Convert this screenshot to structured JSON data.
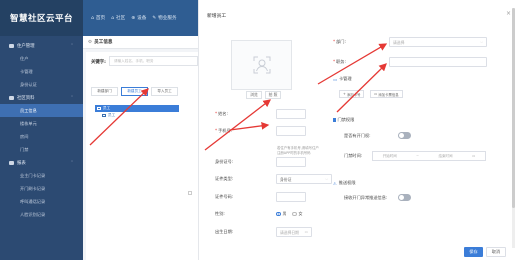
{
  "sidebar": {
    "brand": "智慧社区云平台",
    "groups": [
      {
        "label": "住户管理",
        "items": [
          "住户",
          "卡管理",
          "身份认证"
        ]
      },
      {
        "label": "社区资料",
        "items": [
          "员工信息",
          "楼栋单元",
          "房间",
          "门禁"
        ]
      },
      {
        "label": "报表",
        "items": [
          "业主门卡记录",
          "开门刷卡记录",
          "呼叫通话记录",
          "人脸识别记录"
        ]
      }
    ],
    "active_item": "员工信息"
  },
  "topbar": {
    "items": [
      {
        "icon": "⌂",
        "label": "首页"
      },
      {
        "icon": "⌂",
        "label": "社区"
      },
      {
        "icon": "⊕",
        "label": "设备"
      },
      {
        "icon": "✎",
        "label": "物业服务"
      }
    ]
  },
  "content": {
    "breadcrumb": "员工信息",
    "keyword_label": "关键字:",
    "keyword_placeholder": "请输入姓名、手机、职务",
    "buttons": [
      "新建部门",
      "新建员工",
      "导入员工"
    ],
    "tree": [
      "员工",
      "员工"
    ]
  },
  "modal": {
    "title": "新增员工",
    "close": "×",
    "photo_buttons": [
      "浏览",
      "拍 照"
    ],
    "fields": {
      "name": {
        "label": "姓名:",
        "required": true,
        "value": ""
      },
      "phone": {
        "label": "手机号:",
        "required": true,
        "value": ""
      },
      "phone_hint": "若住户有手机号,请填写住户注册APP时的手机号码",
      "id_number": {
        "label": "身份证号:",
        "value": ""
      },
      "cert_type": {
        "label": "证件类型:",
        "value": "身份证"
      },
      "cert_number": {
        "label": "证件号码:",
        "value": ""
      },
      "gender": {
        "label": "性别:",
        "options": [
          "男",
          "女"
        ],
        "selected": "男"
      },
      "birthday": {
        "label": "出生日期:",
        "placeholder": "请选择日期"
      }
    },
    "right": {
      "department": {
        "label": "部门:",
        "required": true,
        "placeholder": "请选择"
      },
      "position": {
        "label": "职务:",
        "required": true,
        "value": ""
      },
      "card_section": "卡管理",
      "card_buttons": [
        "添加卡号",
        "添加卡票信息"
      ],
      "door_section": "门禁权限",
      "door_toggle_label": "是否有开门权:",
      "door_time_label": "门禁时间:",
      "time_start": "开始时间",
      "time_sep": "~",
      "time_end": "结束时间",
      "notify_section": "推送权限",
      "notify_toggle_label": "接收开门异常推送信息:"
    },
    "footer": {
      "ok": "保存",
      "cancel": "取消"
    }
  }
}
